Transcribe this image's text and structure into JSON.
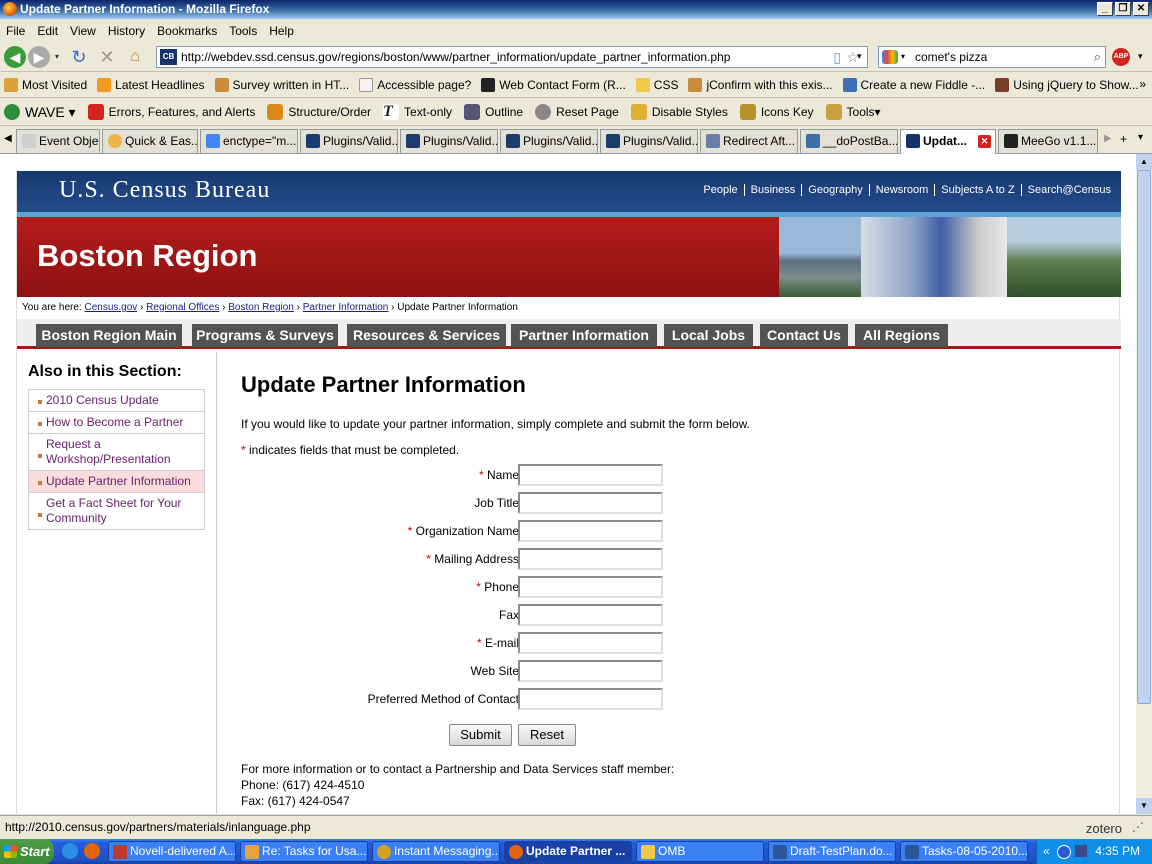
{
  "window": {
    "title": "Update Partner Information - Mozilla Firefox"
  },
  "menu": [
    "File",
    "Edit",
    "View",
    "History",
    "Bookmarks",
    "Tools",
    "Help"
  ],
  "nav": {
    "url": "http://webdev.ssd.census.gov/regions/boston/www/partner_information/update_partner_information.php",
    "search_value": "comet's pizza"
  },
  "bookmarks": [
    {
      "label": "Most Visited",
      "color": "#d9a33a"
    },
    {
      "label": "Latest Headlines",
      "color": "#f39a1e"
    },
    {
      "label": "Survey written in HT...",
      "color": "#c88c3a"
    },
    {
      "label": "Accessible page?",
      "color": "#f4f4f4"
    },
    {
      "label": "Web Contact Form (R...",
      "color": "#222222"
    },
    {
      "label": "CSS",
      "color": "#f1c84b"
    },
    {
      "label": "jConfirm with this exis...",
      "color": "#c88c3a"
    },
    {
      "label": "Create a new Fiddle -...",
      "color": "#3b6fb6"
    },
    {
      "label": "Using jQuery to Show...",
      "color": "#7b3e2a"
    }
  ],
  "wave": [
    {
      "label": "WAVE ▾",
      "color": "#2e8b3a"
    },
    {
      "label": "Errors, Features, and Alerts",
      "color": "#d6221c"
    },
    {
      "label": "Structure/Order",
      "color": "#d98b1a"
    },
    {
      "label": "Text-only",
      "color": "#222222"
    },
    {
      "label": "Outline",
      "color": "#555577"
    },
    {
      "label": "Reset Page",
      "color": "#888888"
    },
    {
      "label": "Disable Styles",
      "color": "#e0b030"
    },
    {
      "label": "Icons Key",
      "color": "#b8902a"
    },
    {
      "label": "Tools▾",
      "color": "#c9a040"
    }
  ],
  "tabs": [
    {
      "label": "Event Objec...",
      "color": "#cfcfcf"
    },
    {
      "label": "Quick & Eas...",
      "color": "#f0b54a"
    },
    {
      "label": "enctype=\"m...",
      "color": "#4285f4"
    },
    {
      "label": "Plugins/Valid...",
      "color": "#1c3c6e"
    },
    {
      "label": "Plugins/Valid...",
      "color": "#1c3c6e"
    },
    {
      "label": "Plugins/Valid...",
      "color": "#1c3c6e"
    },
    {
      "label": "Plugins/Valid...",
      "color": "#1c3c6e"
    },
    {
      "label": "Redirect Aft...",
      "color": "#6a7ea8"
    },
    {
      "label": "__doPostBa...",
      "color": "#3a6ea5"
    },
    {
      "label": "Updat...",
      "color": "#15326b"
    },
    {
      "label": "MeeGo v1.1...",
      "color": "#222222"
    }
  ],
  "site": {
    "logo": "U.S. Census Bureau",
    "topnav": [
      "People",
      "Business",
      "Geography",
      "Newsroom",
      "Subjects A to Z",
      "Search@Census"
    ],
    "region_title": "Boston Region",
    "breadcrumb": {
      "prefix": "You are here:",
      "links": [
        "Census.gov",
        "Regional Offices",
        "Boston Region",
        "Partner Information"
      ],
      "current": "Update Partner Information"
    },
    "mainnav": [
      "Boston Region Main",
      "Programs & Surveys",
      "Resources & Services",
      "Partner Information",
      "Local Jobs",
      "Contact Us",
      "All Regions"
    ]
  },
  "sidebar": {
    "title": "Also in this Section:",
    "items": [
      "2010 Census Update",
      "How to Become a Partner",
      "Request a Workshop/Presentation",
      "Update Partner Information",
      "Get a Fact Sheet for Your Community"
    ]
  },
  "main": {
    "heading": "Update Partner Information",
    "intro": "If you would like to update your partner information, simply complete and submit the form below.",
    "required_note": "indicates fields that must be completed.",
    "required_mark": "*",
    "fields": [
      {
        "label": "Name",
        "required": true
      },
      {
        "label": "Job Title",
        "required": false
      },
      {
        "label": "Organization Name",
        "required": true
      },
      {
        "label": "Mailing Address",
        "required": true
      },
      {
        "label": "Phone",
        "required": true
      },
      {
        "label": "Fax",
        "required": false
      },
      {
        "label": "E-mail",
        "required": true
      },
      {
        "label": "Web Site",
        "required": false
      },
      {
        "label": "Preferred Method of Contact",
        "required": false
      }
    ],
    "submit_label": "Submit",
    "reset_label": "Reset",
    "contact_intro": "For more information or to contact a Partnership and Data Services staff member:",
    "phone": "Phone: (617) 424-4510",
    "fax": "Fax: (617) 424-0547"
  },
  "status": {
    "text": "http://2010.census.gov/partners/materials/inlanguage.php",
    "zotero": "zotero"
  },
  "taskbar": {
    "start": "Start",
    "items": [
      {
        "label": "Novell-delivered A...",
        "color": "#c0392b"
      },
      {
        "label": "Re: Tasks for Usa...",
        "color": "#e8a33a"
      },
      {
        "label": "Instant Messaging...",
        "color": "#d4a020"
      },
      {
        "label": "Update Partner ...",
        "color": "#e2650b"
      },
      {
        "label": "OMB",
        "color": "#f1c84b"
      },
      {
        "label": "Draft-TestPlan.do...",
        "color": "#2b579a"
      },
      {
        "label": "Tasks-08-05-2010....",
        "color": "#2b579a"
      }
    ],
    "clock": "4:35 PM"
  },
  "colors": {
    "banner_blue": "#1f4580",
    "region_red": "#a31818",
    "nav_gray": "#535353",
    "sidebar_link": "#6b2070"
  }
}
